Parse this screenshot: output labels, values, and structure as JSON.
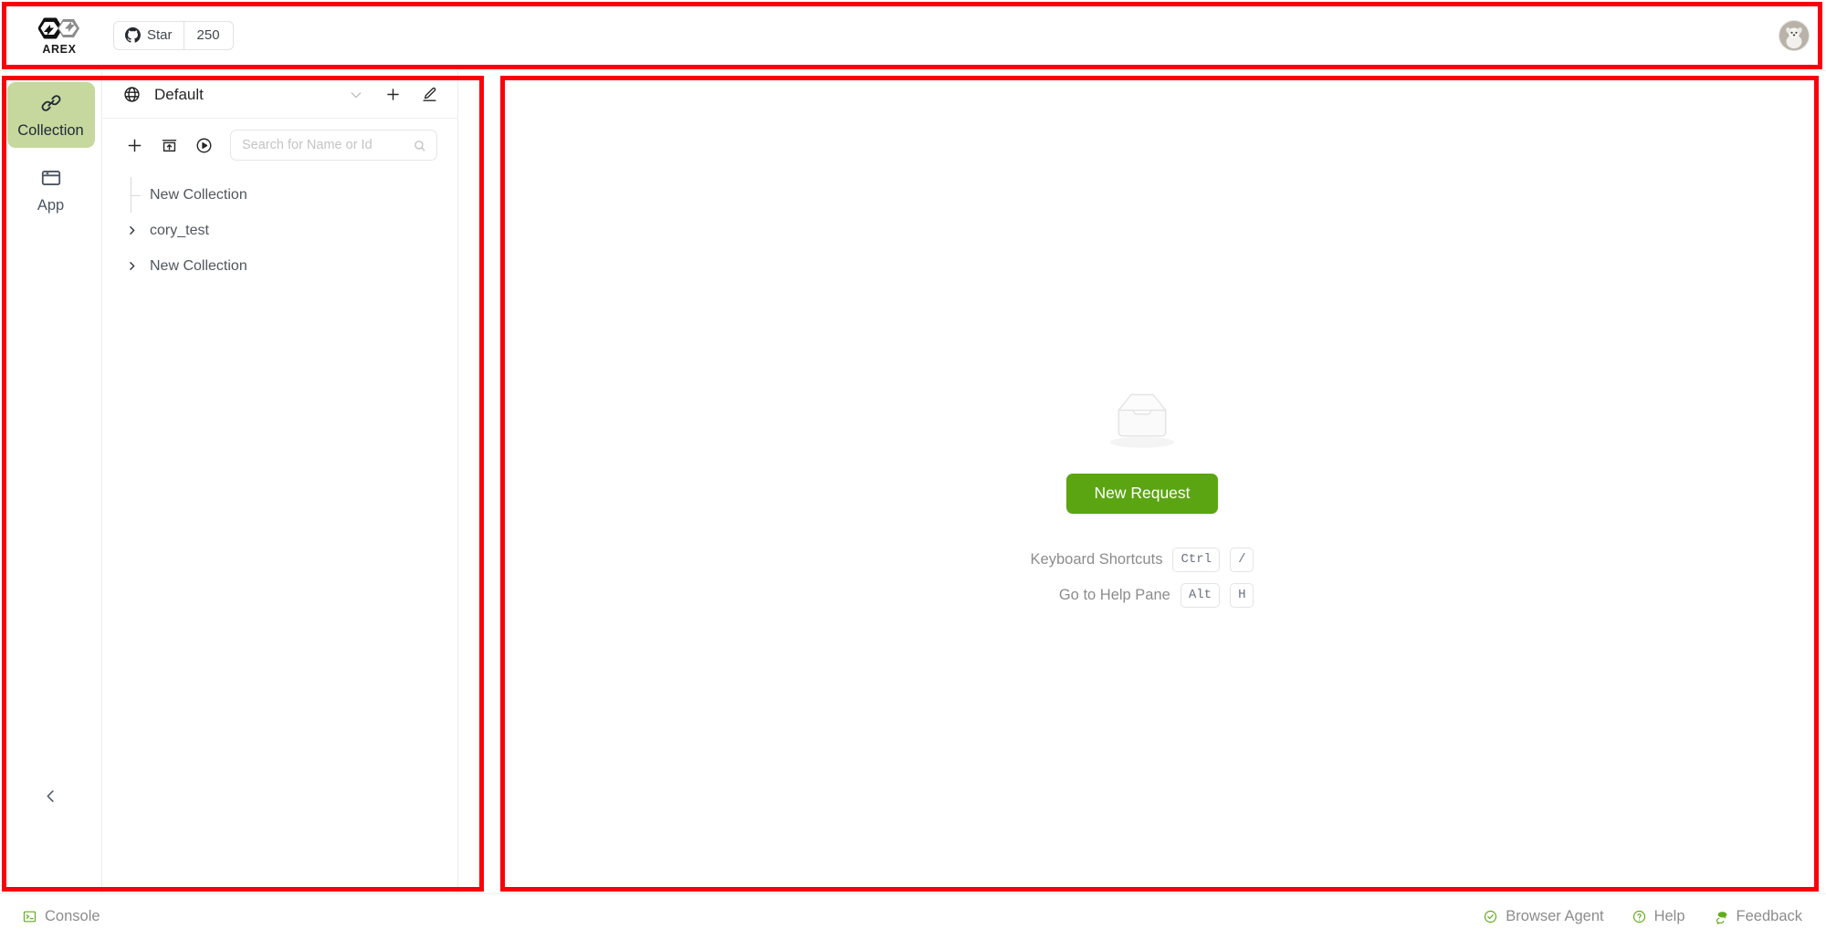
{
  "header": {
    "brand_name": "AREX",
    "logo_icon": "arex-hexagon-logo",
    "github_star_label": "Star",
    "github_star_count": "250",
    "github_icon": "github-icon",
    "avatar_icon": "user-avatar-dog-photo"
  },
  "rail": {
    "items": [
      {
        "label": "Collection",
        "icon": "link-chain-icon",
        "active": true
      },
      {
        "label": "App",
        "icon": "browser-window-icon",
        "active": false
      }
    ],
    "collapse_icon": "chevron-left-icon"
  },
  "panel": {
    "workspace_icon": "globe-icon",
    "workspace_name": "Default",
    "head_icons": [
      "chevron-down-icon",
      "plus-icon",
      "edit-pen-icon"
    ],
    "toolbar_icons": [
      "plus-icon",
      "import-box-icon",
      "play-circle-icon"
    ],
    "search": {
      "placeholder": "Search for Name or Id",
      "value": "",
      "icon": "search-icon"
    },
    "tree": [
      {
        "label": "New Collection",
        "type": "child",
        "expanded": false
      },
      {
        "label": "cory_test",
        "type": "folder",
        "expanded": false
      },
      {
        "label": "New Collection",
        "type": "folder",
        "expanded": false
      }
    ]
  },
  "main": {
    "empty_icon": "empty-inbox-illustration",
    "new_request_label": "New Request",
    "shortcuts": [
      {
        "label": "Keyboard Shortcuts",
        "keys": [
          "Ctrl",
          "/"
        ]
      },
      {
        "label": "Go to Help Pane",
        "keys": [
          "Alt",
          "H"
        ]
      }
    ]
  },
  "statusbar": {
    "left": [
      {
        "label": "Console",
        "icon": "terminal-console-icon"
      }
    ],
    "right": [
      {
        "label": "Browser Agent",
        "icon": "check-circle-icon"
      },
      {
        "label": "Help",
        "icon": "question-circle-icon"
      },
      {
        "label": "Feedback",
        "icon": "comment-bubble-icon"
      }
    ]
  },
  "colors": {
    "accent_green": "#5ba512",
    "active_rail_bg": "#c6d89d",
    "status_icon_green": "#63ab1e",
    "annotation_red": "#fb0007"
  }
}
